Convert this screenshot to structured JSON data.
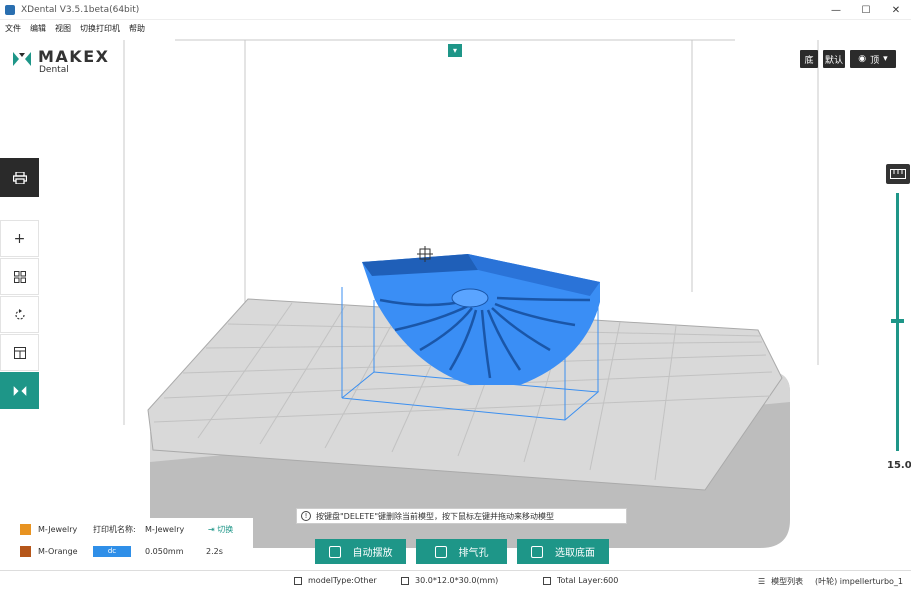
{
  "window": {
    "title": "XDental V3.5.1beta(64bit)",
    "controls": [
      "—",
      "☐",
      "✕"
    ]
  },
  "menu": [
    "文件",
    "编辑",
    "视图",
    "切换打印机",
    "帮助"
  ],
  "logo": {
    "brand": "MAKEX",
    "sub": "Dental"
  },
  "view_buttons": {
    "bottom": "底",
    "default": "默认",
    "top": "顶"
  },
  "slider": {
    "value": "15.0"
  },
  "hint": {
    "info": "!",
    "text": "按键盘\"DELETE\"键删除当前模型，按下鼠标左键并拖动来移动模型"
  },
  "actions": [
    {
      "label": "自动摆放"
    },
    {
      "label": "排气孔"
    },
    {
      "label": "选取底面"
    }
  ],
  "materials": {
    "row1": {
      "name": "M-Jewelry",
      "printer_label": "打印机名称:",
      "printer_value": "M-Jewelry",
      "switch": "切换",
      "color": "#e89321"
    },
    "row2": {
      "name": "M-Orange",
      "pill": "dc",
      "layer": "0.050mm",
      "time": "2.2s",
      "color": "#b5561a"
    }
  },
  "status": {
    "model_type": "modelType:Other",
    "dimensions": "30.0*12.0*30.0(mm)",
    "total_layer": "Total Layer:600",
    "model_list": "模型列表",
    "model_name": "(叶轮) impellerturbo_1"
  }
}
